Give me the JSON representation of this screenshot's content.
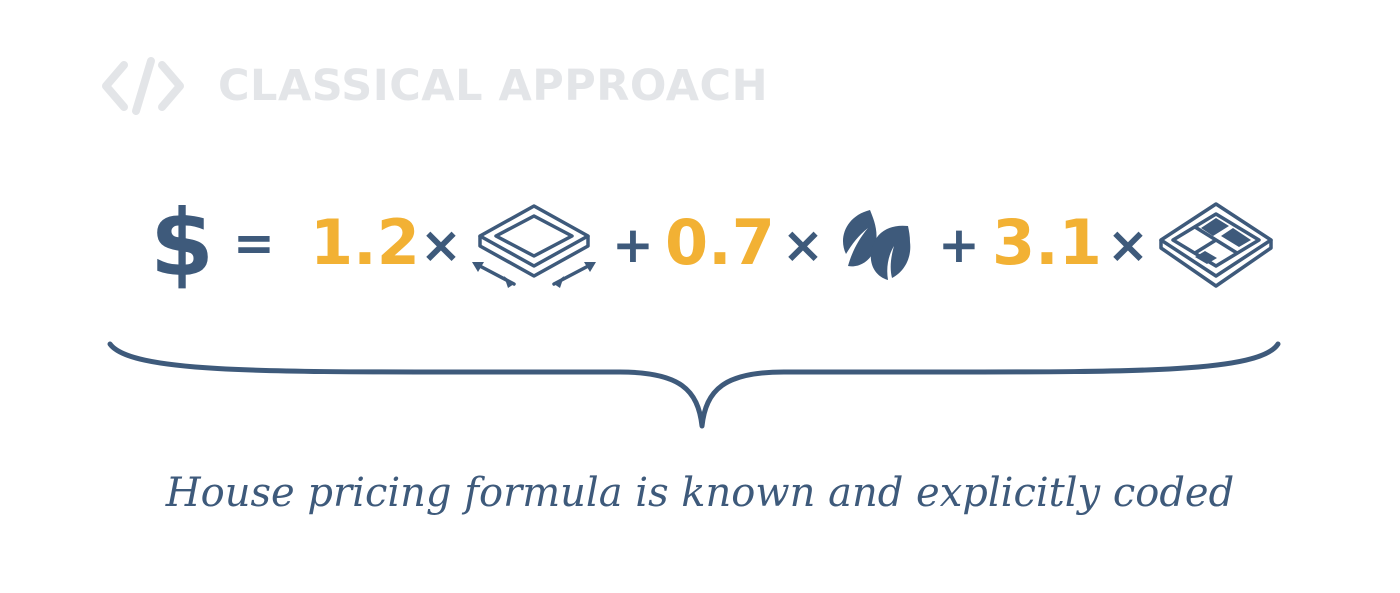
{
  "header": {
    "icon": "code-icon",
    "title": "CLASSICAL APPROACH"
  },
  "formula": {
    "result_symbol": "$",
    "equals": "=",
    "terms": [
      {
        "operator": "",
        "coefficient": "1.2",
        "multiply": "×",
        "icon": "floor-area-icon"
      },
      {
        "operator": "+",
        "coefficient": "0.7",
        "multiply": "×",
        "icon": "leaf-icon"
      },
      {
        "operator": "+",
        "coefficient": "3.1",
        "multiply": "×",
        "icon": "floor-plan-icon"
      }
    ]
  },
  "caption": "House pricing formula is known and explicitly coded",
  "colors": {
    "primary": "#3e5a7b",
    "accent": "#f2b134",
    "muted": "#e3e5e8"
  }
}
